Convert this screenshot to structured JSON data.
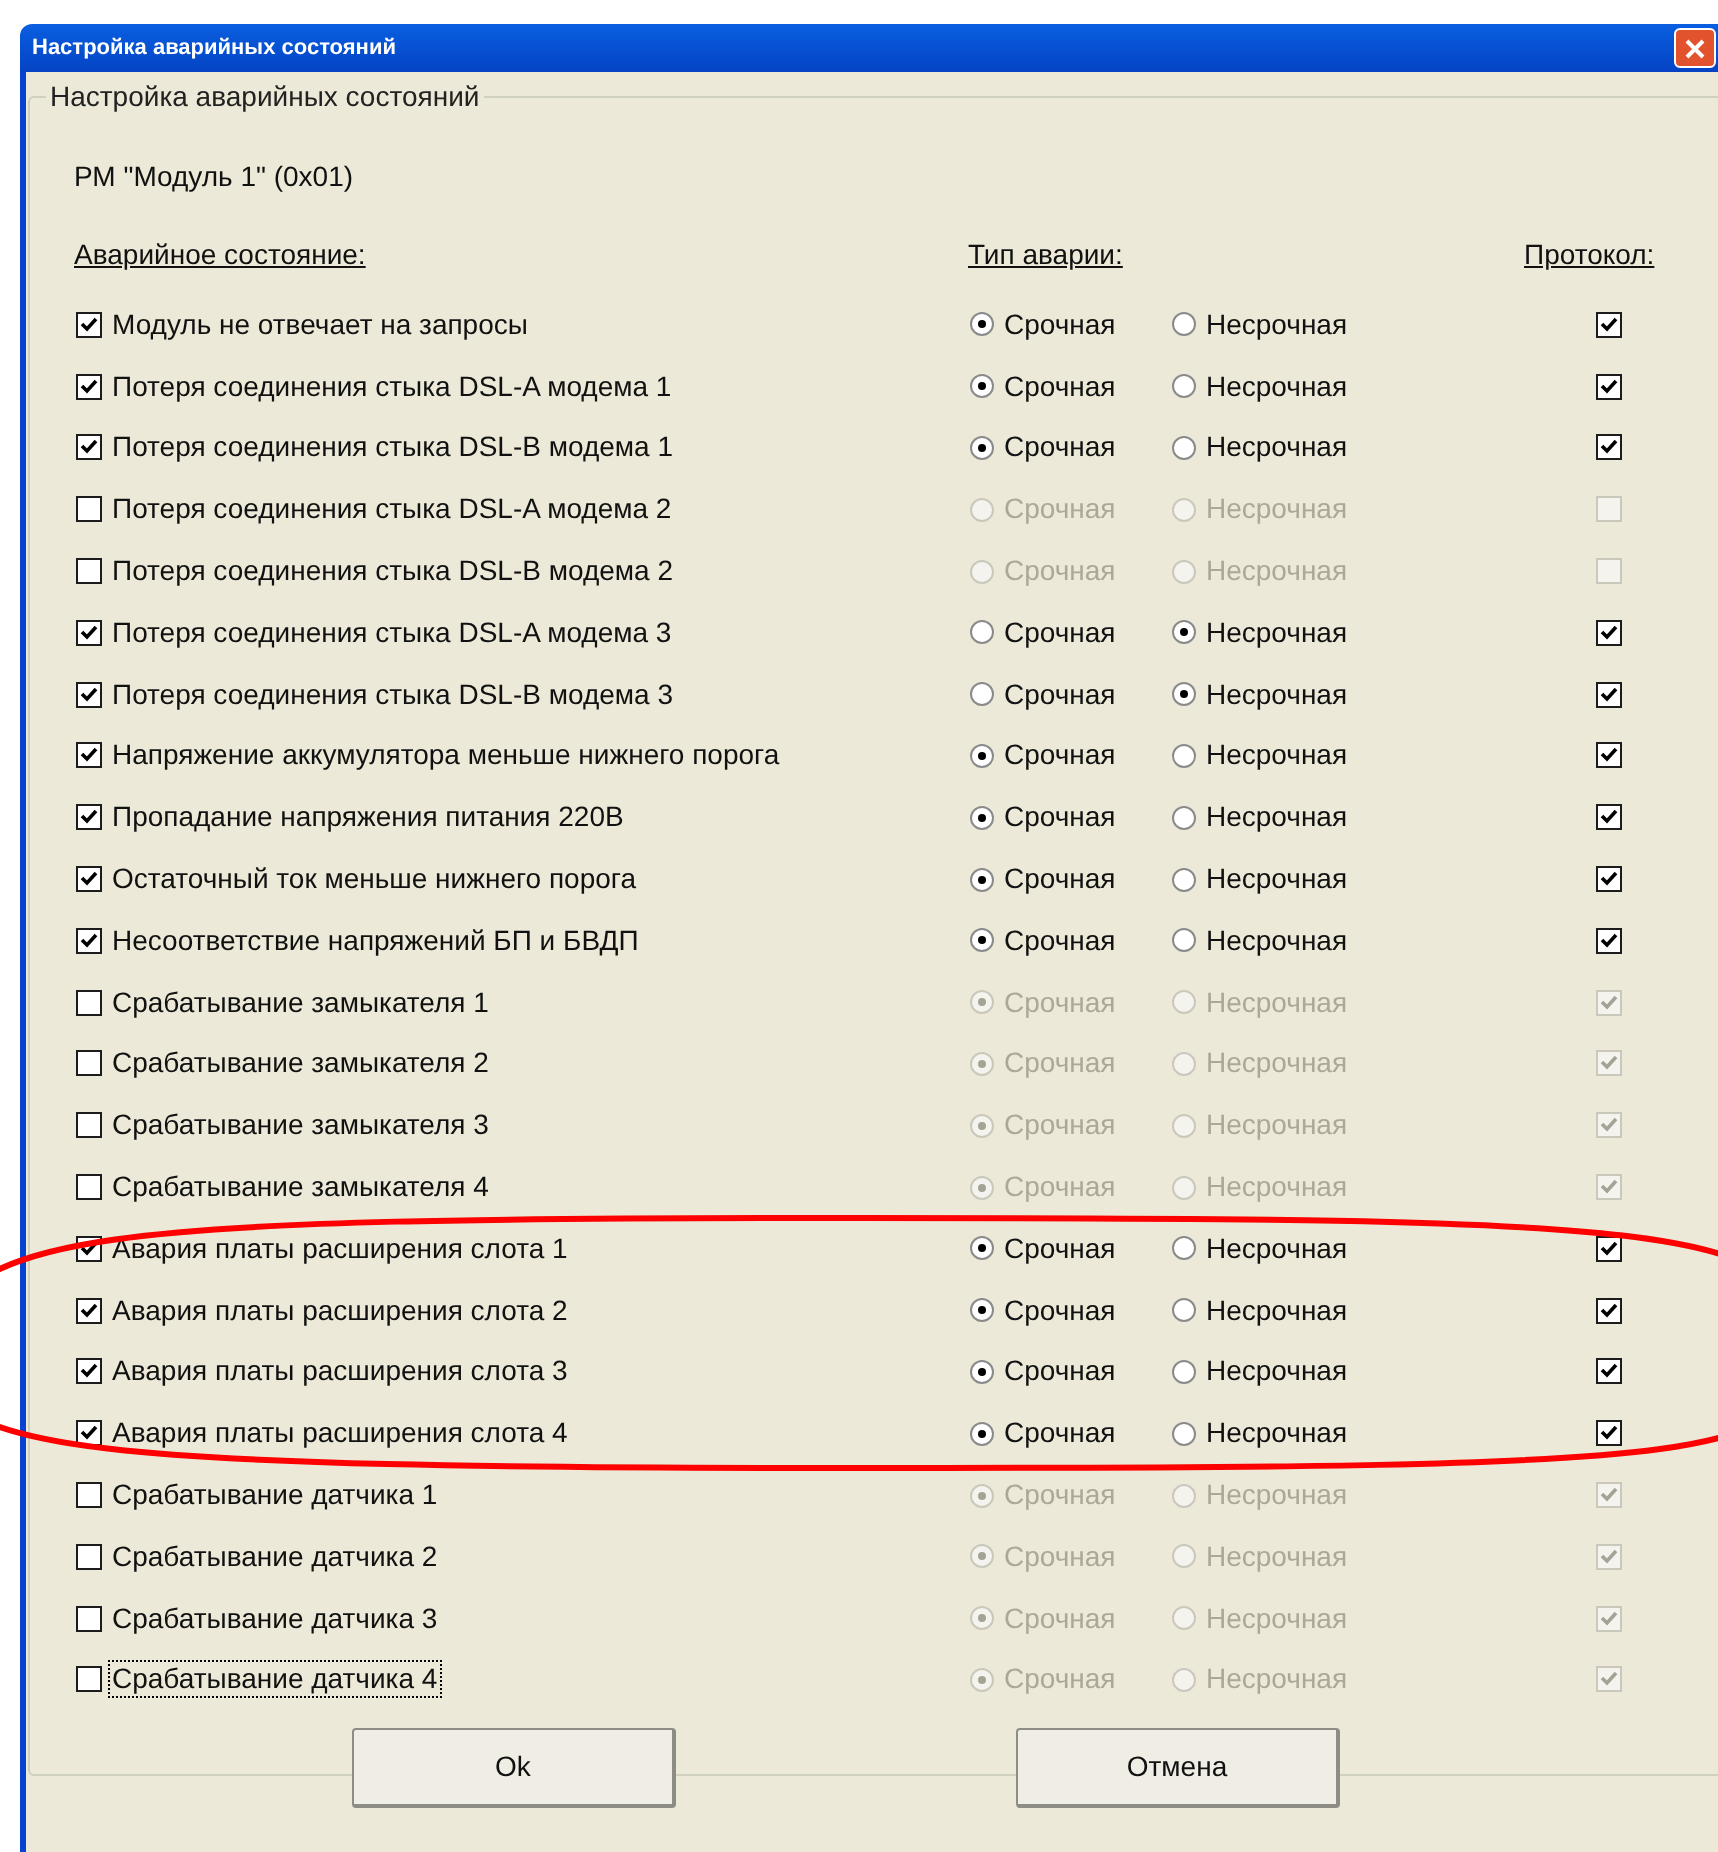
{
  "window": {
    "title": "Настройка аварийных состояний"
  },
  "group": {
    "title": "Настройка аварийных состояний"
  },
  "device": "РМ \"Модуль 1\" (0x01)",
  "headers": {
    "state": "Аварийное состояние:",
    "type": "Тип аварии:",
    "protocol": "Протокол:"
  },
  "rows": [
    {
      "label": "Модуль не отвечает на запросы",
      "checked": true,
      "disabled": false,
      "focused": false,
      "types": [
        {
          "label": "Срочная",
          "selected": true
        },
        {
          "label": "Несрочная",
          "selected": false
        }
      ],
      "protocol": true
    },
    {
      "label": "Потеря соединения стыка DSL-A модема 1",
      "checked": true,
      "disabled": false,
      "focused": false,
      "types": [
        {
          "label": "Срочная",
          "selected": true
        },
        {
          "label": "Несрочная",
          "selected": false
        }
      ],
      "protocol": true
    },
    {
      "label": "Потеря соединения стыка DSL-B модема 1",
      "checked": true,
      "disabled": false,
      "focused": false,
      "types": [
        {
          "label": "Срочная",
          "selected": true
        },
        {
          "label": "Несрочная",
          "selected": false
        }
      ],
      "protocol": true
    },
    {
      "label": "Потеря соединения стыка DSL-A модема 2",
      "checked": false,
      "disabled": true,
      "focused": false,
      "types": [
        {
          "label": "Срочная",
          "selected": false
        },
        {
          "label": "Несрочная",
          "selected": false
        }
      ],
      "protocol": false
    },
    {
      "label": "Потеря соединения стыка DSL-B модема 2",
      "checked": false,
      "disabled": true,
      "focused": false,
      "types": [
        {
          "label": "Срочная",
          "selected": false
        },
        {
          "label": "Несрочная",
          "selected": false
        }
      ],
      "protocol": false
    },
    {
      "label": "Потеря соединения стыка DSL-A модема 3",
      "checked": true,
      "disabled": false,
      "focused": false,
      "types": [
        {
          "label": "Срочная",
          "selected": false
        },
        {
          "label": "Несрочная",
          "selected": true
        }
      ],
      "protocol": true
    },
    {
      "label": "Потеря соединения стыка DSL-B модема 3",
      "checked": true,
      "disabled": false,
      "focused": false,
      "types": [
        {
          "label": "Срочная",
          "selected": false
        },
        {
          "label": "Несрочная",
          "selected": true
        }
      ],
      "protocol": true
    },
    {
      "label": "Напряжение аккумулятора меньше нижнего порога",
      "checked": true,
      "disabled": false,
      "focused": false,
      "types": [
        {
          "label": "Срочная",
          "selected": true
        },
        {
          "label": "Несрочная",
          "selected": false
        }
      ],
      "protocol": true
    },
    {
      "label": "Пропадание напряжения питания 220В",
      "checked": true,
      "disabled": false,
      "focused": false,
      "types": [
        {
          "label": "Срочная",
          "selected": true
        },
        {
          "label": "Несрочная",
          "selected": false
        }
      ],
      "protocol": true
    },
    {
      "label": "Остаточный ток меньше нижнего порога",
      "checked": true,
      "disabled": false,
      "focused": false,
      "types": [
        {
          "label": "Срочная",
          "selected": true
        },
        {
          "label": "Несрочная",
          "selected": false
        }
      ],
      "protocol": true
    },
    {
      "label": "Несоответствие напряжений БП и БВДП",
      "checked": true,
      "disabled": false,
      "focused": false,
      "types": [
        {
          "label": "Срочная",
          "selected": true
        },
        {
          "label": "Несрочная",
          "selected": false
        }
      ],
      "protocol": true
    },
    {
      "label": "Срабатывание замыкателя 1",
      "checked": false,
      "disabled": true,
      "focused": false,
      "types": [
        {
          "label": "Срочная",
          "selected": true
        },
        {
          "label": "Несрочная",
          "selected": false
        }
      ],
      "protocol": true
    },
    {
      "label": "Срабатывание замыкателя 2",
      "checked": false,
      "disabled": true,
      "focused": false,
      "types": [
        {
          "label": "Срочная",
          "selected": true
        },
        {
          "label": "Несрочная",
          "selected": false
        }
      ],
      "protocol": true
    },
    {
      "label": "Срабатывание замыкателя 3",
      "checked": false,
      "disabled": true,
      "focused": false,
      "types": [
        {
          "label": "Срочная",
          "selected": true
        },
        {
          "label": "Несрочная",
          "selected": false
        }
      ],
      "protocol": true
    },
    {
      "label": "Срабатывание замыкателя 4",
      "checked": false,
      "disabled": true,
      "focused": false,
      "types": [
        {
          "label": "Срочная",
          "selected": true
        },
        {
          "label": "Несрочная",
          "selected": false
        }
      ],
      "protocol": true
    },
    {
      "label": "Авария платы расширения слота 1",
      "checked": true,
      "disabled": false,
      "focused": false,
      "types": [
        {
          "label": "Срочная",
          "selected": true
        },
        {
          "label": "Несрочная",
          "selected": false
        }
      ],
      "protocol": true
    },
    {
      "label": "Авария платы расширения слота 2",
      "checked": true,
      "disabled": false,
      "focused": false,
      "types": [
        {
          "label": "Срочная",
          "selected": true
        },
        {
          "label": "Несрочная",
          "selected": false
        }
      ],
      "protocol": true
    },
    {
      "label": "Авария платы расширения слота 3",
      "checked": true,
      "disabled": false,
      "focused": false,
      "types": [
        {
          "label": "Срочная",
          "selected": true
        },
        {
          "label": "Несрочная",
          "selected": false
        }
      ],
      "protocol": true
    },
    {
      "label": "Авария платы расширения слота 4",
      "checked": true,
      "disabled": false,
      "focused": false,
      "types": [
        {
          "label": "Срочная",
          "selected": true
        },
        {
          "label": "Несрочная",
          "selected": false
        }
      ],
      "protocol": true
    },
    {
      "label": "Срабатывание датчика 1",
      "checked": false,
      "disabled": true,
      "focused": false,
      "types": [
        {
          "label": "Срочная",
          "selected": true
        },
        {
          "label": "Несрочная",
          "selected": false
        }
      ],
      "protocol": true
    },
    {
      "label": "Срабатывание датчика 2",
      "checked": false,
      "disabled": true,
      "focused": false,
      "types": [
        {
          "label": "Срочная",
          "selected": true
        },
        {
          "label": "Несрочная",
          "selected": false
        }
      ],
      "protocol": true
    },
    {
      "label": "Срабатывание датчика 3",
      "checked": false,
      "disabled": true,
      "focused": false,
      "types": [
        {
          "label": "Срочная",
          "selected": true
        },
        {
          "label": "Несрочная",
          "selected": false
        }
      ],
      "protocol": true
    },
    {
      "label": "Срабатывание датчика 4",
      "checked": false,
      "disabled": true,
      "focused": true,
      "types": [
        {
          "label": "Срочная",
          "selected": true
        },
        {
          "label": "Несрочная",
          "selected": false
        }
      ],
      "protocol": true
    }
  ],
  "buttons": [
    "Ok",
    "Отмена"
  ]
}
